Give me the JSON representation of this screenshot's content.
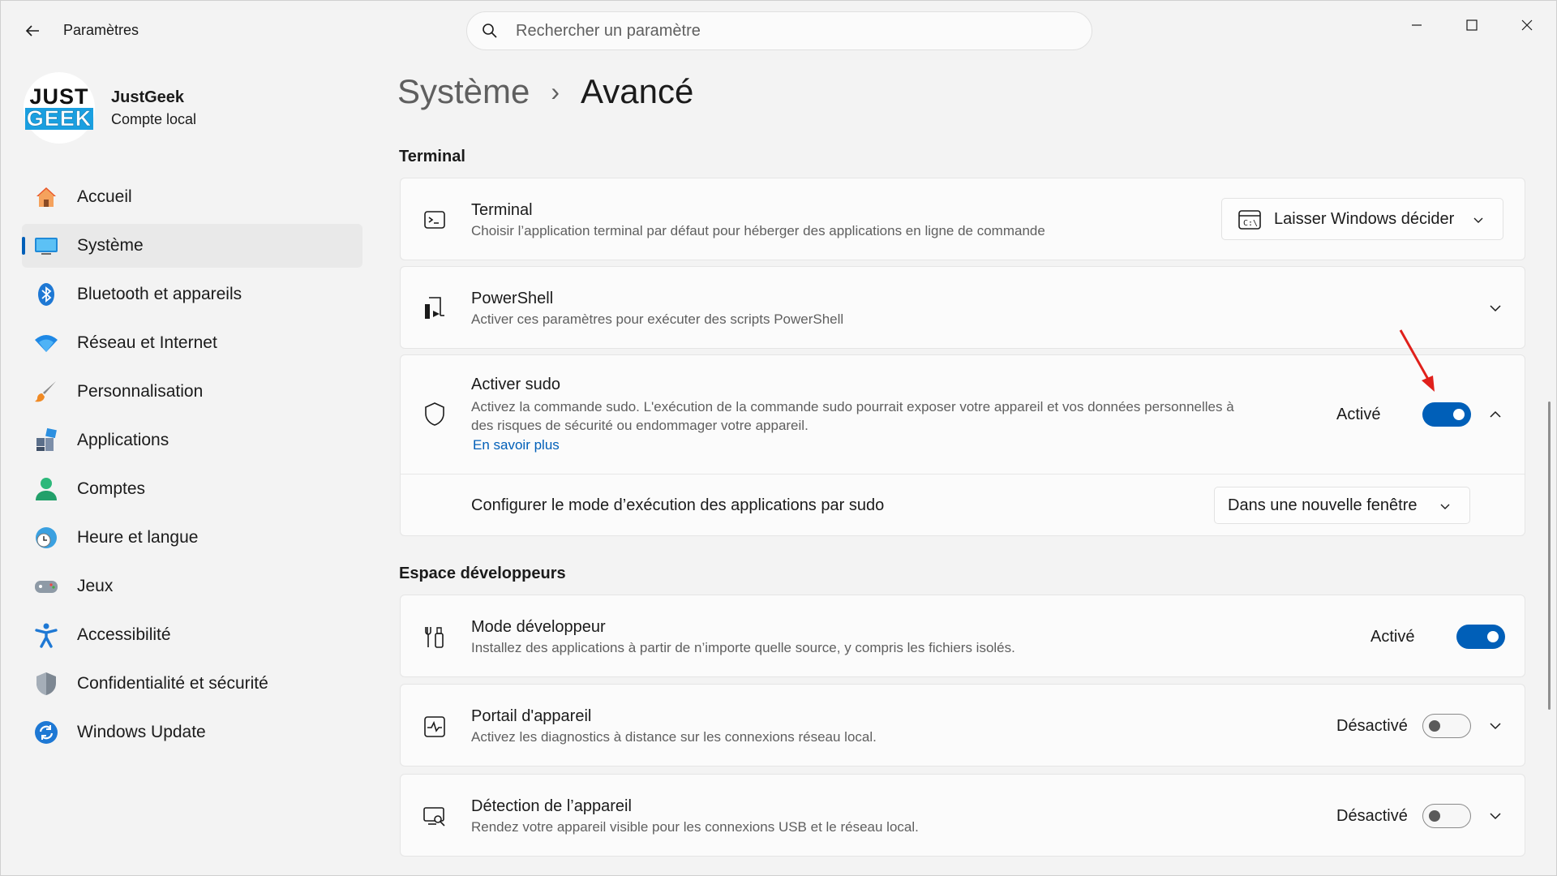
{
  "window": {
    "app_title": "Paramètres",
    "search_placeholder": "Rechercher un paramètre"
  },
  "profile": {
    "logo_line1": "JUST",
    "logo_line2": "GEEK",
    "name": "JustGeek",
    "account_type": "Compte local"
  },
  "sidebar": {
    "items": [
      {
        "label": "Accueil",
        "icon": "home-icon"
      },
      {
        "label": "Système",
        "icon": "system-icon",
        "active": true
      },
      {
        "label": "Bluetooth et appareils",
        "icon": "bluetooth-icon"
      },
      {
        "label": "Réseau et Internet",
        "icon": "wifi-icon"
      },
      {
        "label": "Personnalisation",
        "icon": "brush-icon"
      },
      {
        "label": "Applications",
        "icon": "apps-icon"
      },
      {
        "label": "Comptes",
        "icon": "person-icon"
      },
      {
        "label": "Heure et langue",
        "icon": "clock-globe-icon"
      },
      {
        "label": "Jeux",
        "icon": "gamepad-icon"
      },
      {
        "label": "Accessibilité",
        "icon": "accessibility-icon"
      },
      {
        "label": "Confidentialité et sécurité",
        "icon": "shield-icon"
      },
      {
        "label": "Windows Update",
        "icon": "update-icon"
      }
    ]
  },
  "breadcrumb": {
    "parent": "Système",
    "separator": "›",
    "current": "Avancé"
  },
  "sections": {
    "terminal_title": "Terminal",
    "dev_title": "Espace développeurs"
  },
  "cards": {
    "terminal": {
      "title": "Terminal",
      "desc": "Choisir l’application terminal par défaut pour héberger des applications en ligne de commande",
      "dropdown_value": "Laisser Windows décider"
    },
    "powershell": {
      "title": "PowerShell",
      "desc": "Activer ces paramètres pour exécuter des scripts PowerShell"
    },
    "sudo": {
      "title": "Activer sudo",
      "desc_line1": "Activez la commande sudo. L'exécution de la commande sudo pourrait exposer votre appareil et vos données personnelles à",
      "desc_line2": "des risques de sécurité ou endommager votre appareil.",
      "link": "En savoir plus",
      "state": "Activé",
      "toggle_on": true,
      "sub_label": "Configurer le mode d’exécution des applications par sudo",
      "sub_dropdown_value": "Dans une nouvelle fenêtre"
    },
    "dev_mode": {
      "title": "Mode développeur",
      "desc": "Installez des applications à partir de n’importe quelle source, y compris les fichiers isolés.",
      "state": "Activé",
      "toggle_on": true
    },
    "device_portal": {
      "title": "Portail d'appareil",
      "desc": "Activez les diagnostics à distance sur les connexions réseau local.",
      "state": "Désactivé",
      "toggle_on": false
    },
    "device_discovery": {
      "title": "Détection de l’appareil",
      "desc": "Rendez votre appareil visible pour les connexions USB et le réseau local.",
      "state": "Désactivé",
      "toggle_on": false
    }
  },
  "colors": {
    "accent": "#005fb8",
    "annotation_arrow": "#e0201b"
  }
}
